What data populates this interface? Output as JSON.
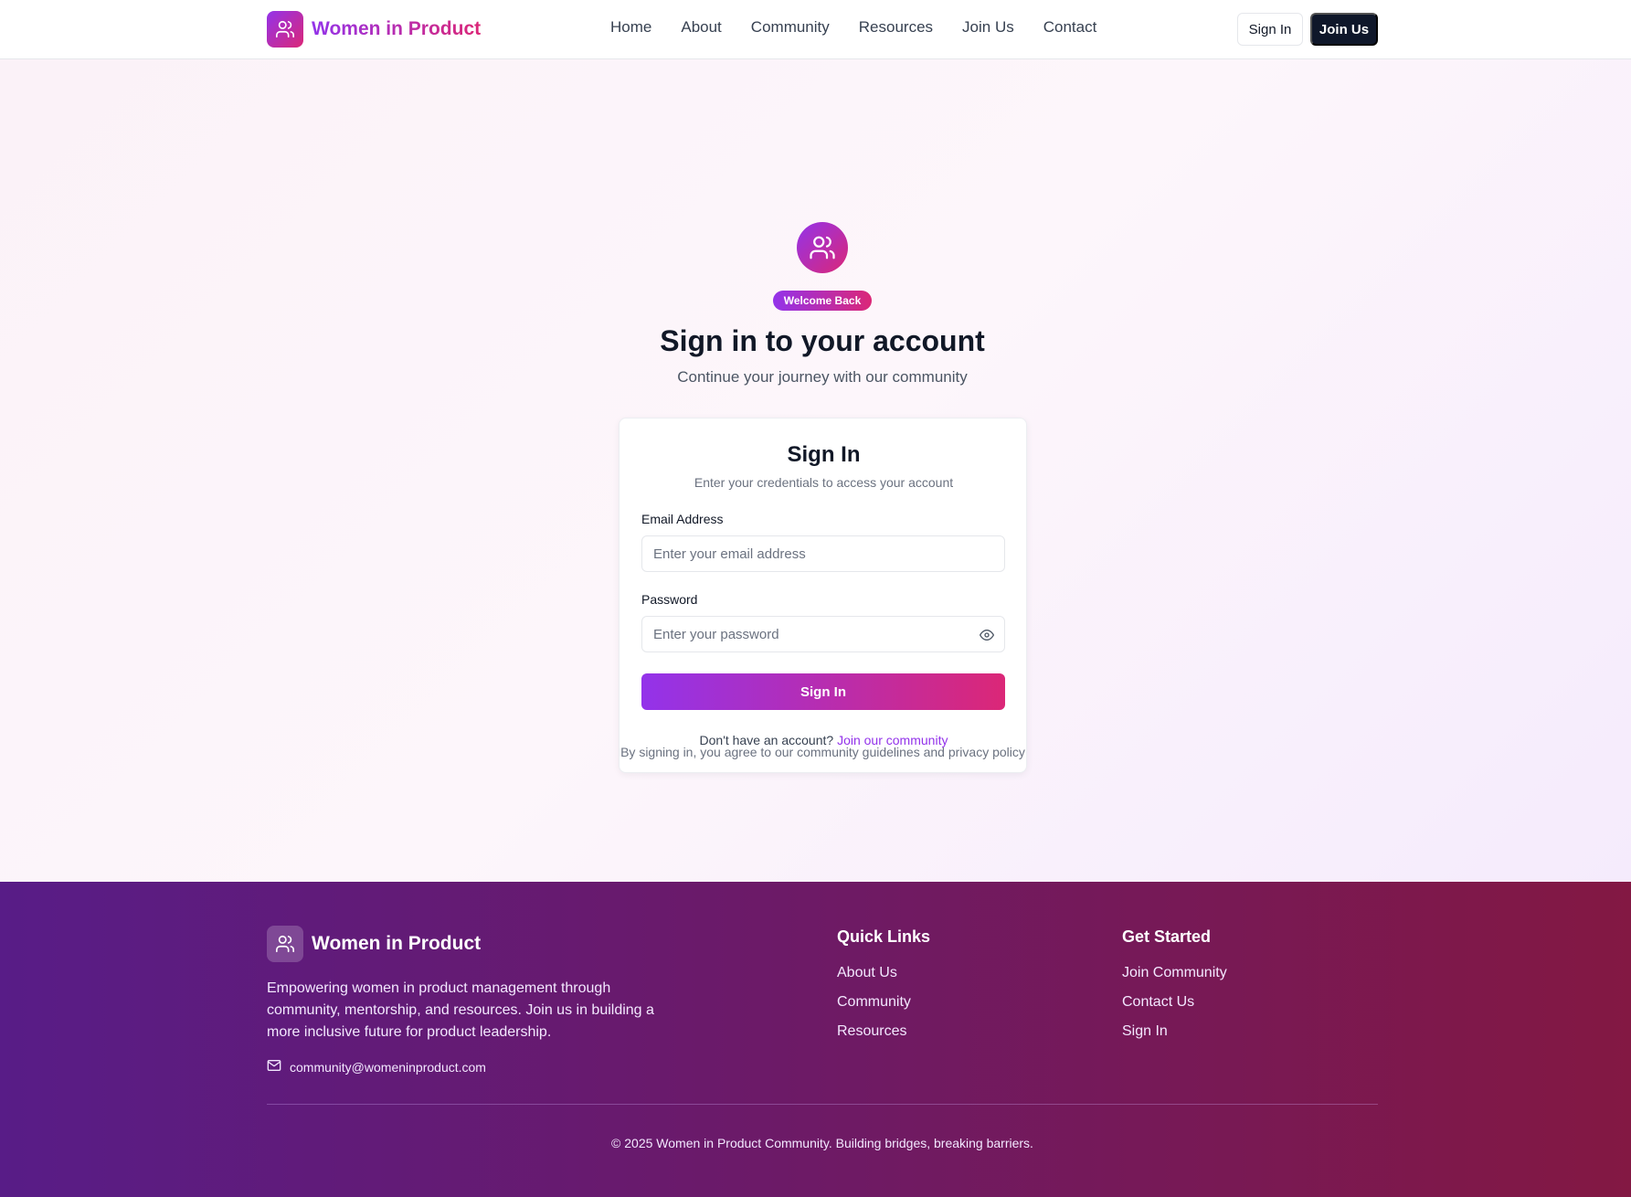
{
  "nav": {
    "brand": "Women in Product",
    "links": [
      "Home",
      "About",
      "Community",
      "Resources",
      "Join Us",
      "Contact"
    ],
    "signin_label": "Sign In",
    "join_label": "Join Us"
  },
  "hero": {
    "badge": "Welcome Back",
    "title": "Sign in to your account",
    "subtitle": "Continue your journey with our community"
  },
  "form": {
    "title": "Sign In",
    "subtitle": "Enter your credentials to access your account",
    "email_label": "Email Address",
    "email_placeholder": "Enter your email address",
    "email_value": "",
    "password_label": "Password",
    "password_placeholder": "Enter your password",
    "password_value": "",
    "submit_label": "Sign In",
    "signup_prompt": "Don't have an account?",
    "signup_link": "Join our community"
  },
  "legal": "By signing in, you agree to our community guidelines and privacy policy",
  "footer": {
    "brand": "Women in Product",
    "description": "Empowering women in product management through community, mentorship, and resources. Join us in building a more inclusive future for product leadership.",
    "email": "community@womeninproduct.com",
    "quick_links": {
      "title": "Quick Links",
      "items": [
        "About Us",
        "Community",
        "Resources"
      ]
    },
    "get_started": {
      "title": "Get Started",
      "items": [
        "Join Community",
        "Contact Us",
        "Sign In"
      ]
    },
    "copyright": "© 2025 Women in Product Community. Building bridges, breaking barriers."
  },
  "icons": {
    "brand_logo": "users-icon",
    "hero_icon": "users-icon",
    "password_toggle": "eye-icon",
    "footer_email": "mail-icon"
  },
  "colors": {
    "accent_start": "#9333ea",
    "accent_end": "#db2777",
    "nav_join_bg": "#0f172a",
    "footer_start": "#581c87",
    "footer_end": "#831843"
  }
}
